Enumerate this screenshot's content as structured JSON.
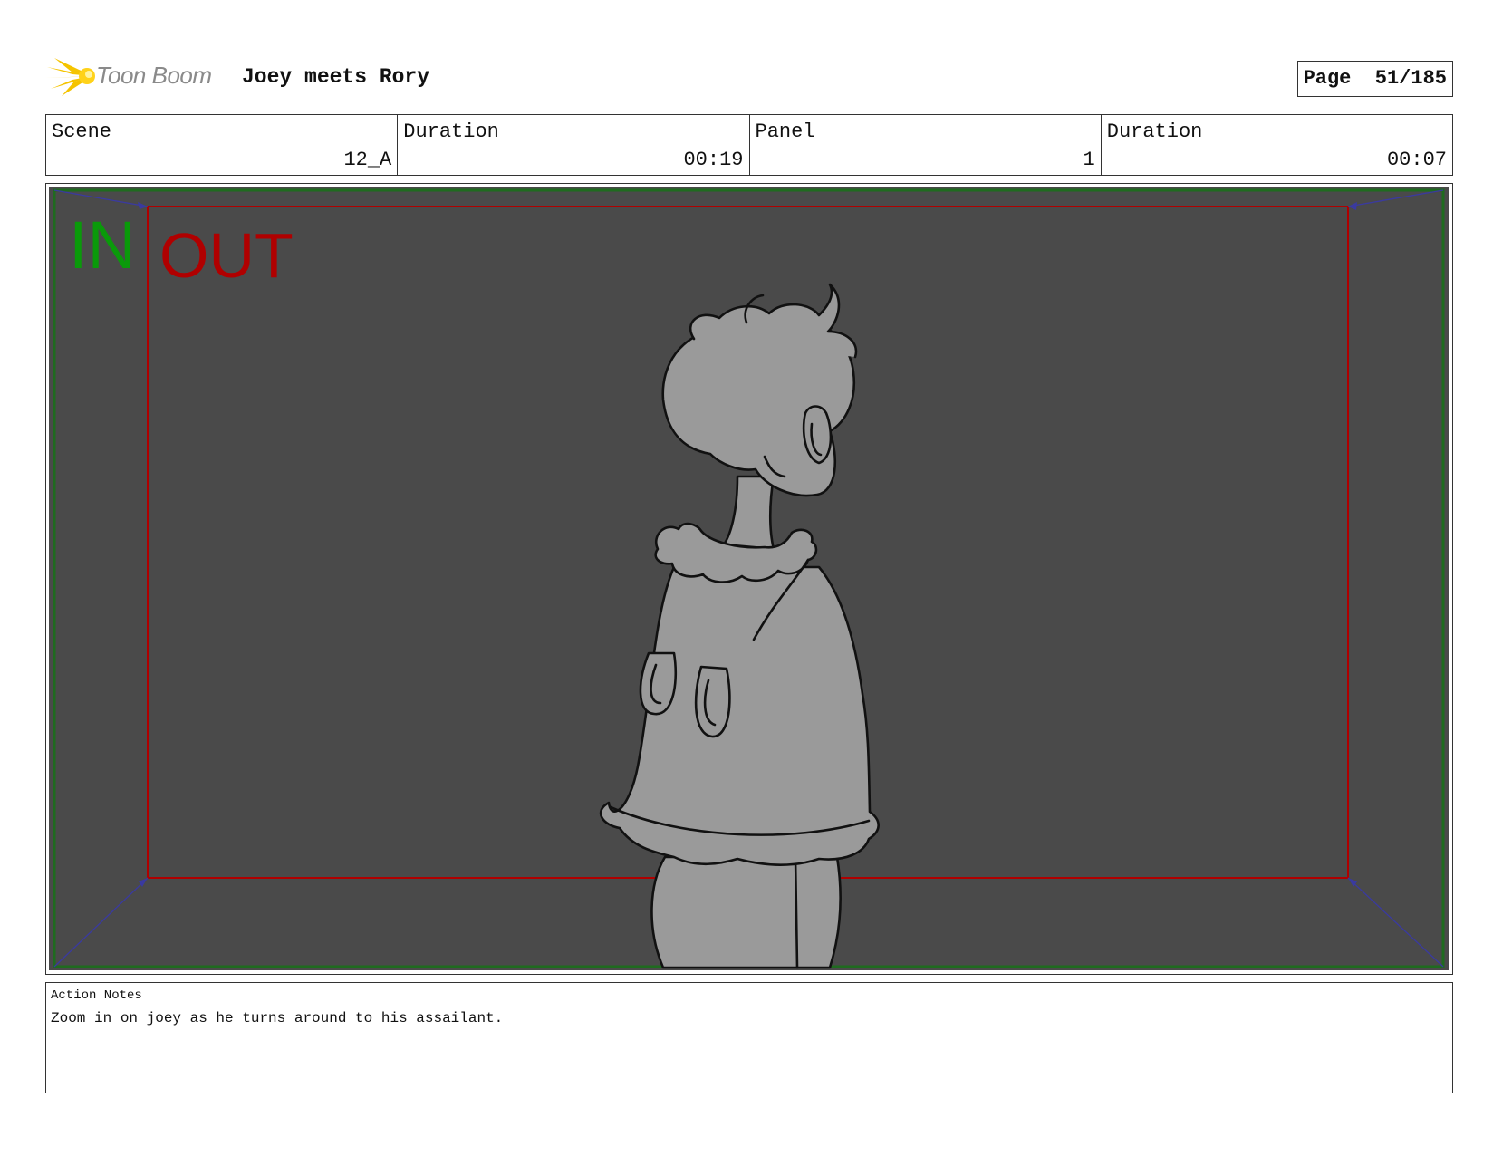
{
  "header": {
    "logo_text": "Toon Boom",
    "project_title": "Joey meets Rory",
    "page_label": "Page",
    "page_number": "51/185"
  },
  "info": {
    "scene_label": "Scene",
    "scene_value": "12_A",
    "scene_duration_label": "Duration",
    "scene_duration_value": "00:19",
    "panel_label": "Panel",
    "panel_value": "1",
    "panel_duration_label": "Duration",
    "panel_duration_value": "00:07"
  },
  "panel": {
    "in_label": "IN",
    "out_label": "OUT",
    "in_color": "#0a9a0a",
    "out_color": "#b00000",
    "background_color": "#4a4a4a"
  },
  "notes": {
    "label": "Action Notes",
    "text": "Zoom in on joey as he turns around to his assailant."
  }
}
